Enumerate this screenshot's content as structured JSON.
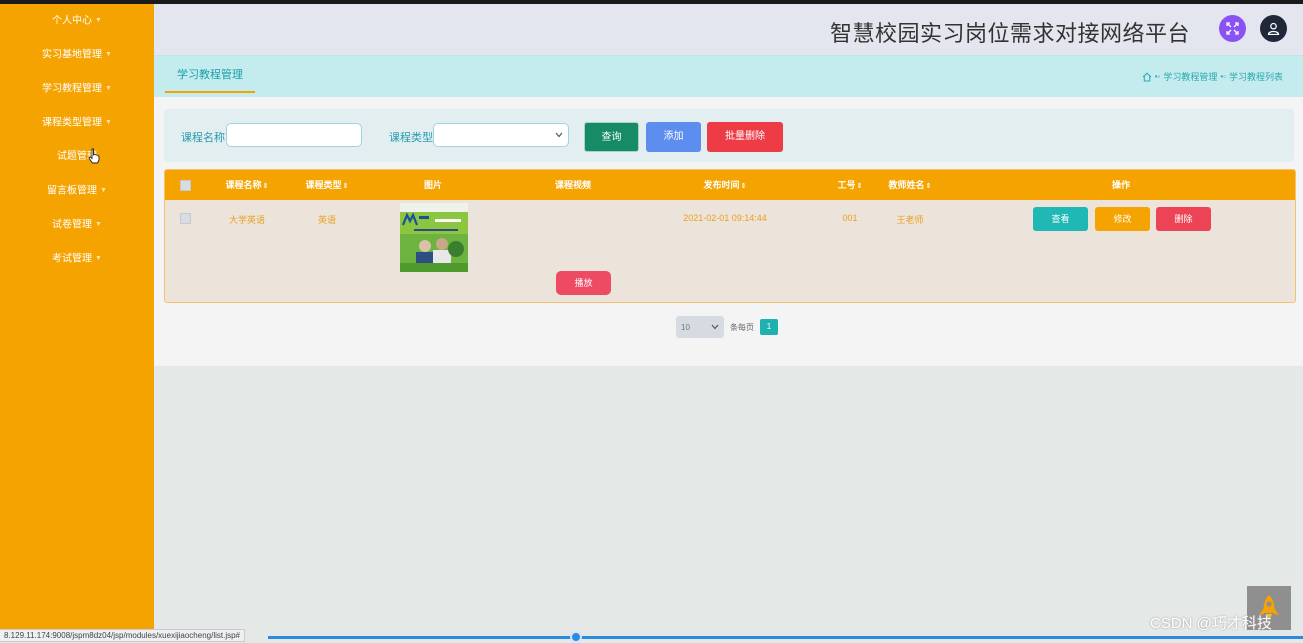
{
  "sidebar": {
    "items": [
      {
        "label": "个人中心",
        "caret": true
      },
      {
        "label": "实习基地管理",
        "caret": true
      },
      {
        "label": "学习教程管理",
        "caret": true
      },
      {
        "label": "课程类型管理",
        "caret": true
      },
      {
        "label": "试题管理",
        "caret": false
      },
      {
        "label": "留言板管理",
        "caret": true
      },
      {
        "label": "试卷管理",
        "caret": true
      },
      {
        "label": "考试管理",
        "caret": true
      }
    ]
  },
  "header": {
    "title": "智慧校园实习岗位需求对接网络平台"
  },
  "tabs": {
    "active": "学习教程管理"
  },
  "breadcrumb": {
    "items": [
      "学习教程管理",
      "学习教程列表"
    ]
  },
  "search": {
    "name_label": "课程名称",
    "name_value": "",
    "type_label": "课程类型",
    "type_value": "",
    "query_button": "查询",
    "add_button": "添加",
    "batch_delete_button": "批量删除"
  },
  "table": {
    "columns": [
      "课程名称",
      "课程类型",
      "图片",
      "课程视频",
      "发布时间",
      "工号",
      "教师姓名",
      "操作"
    ],
    "rows": [
      {
        "course_name": "大学英语",
        "course_type": "英语",
        "video_button": "播放",
        "publish_time": "2021-02-01 09:14:44",
        "job_number": "001",
        "teacher_name": "王老师",
        "view_button": "查看",
        "edit_button": "修改",
        "delete_button": "删除"
      }
    ]
  },
  "pagination": {
    "page_size": "10",
    "per_page_label": "条每页",
    "current_page": "1"
  },
  "status_bar": {
    "url": "8.129.11.174:9008/jspm8dz04/jsp/modules/xuexijiaocheng/list.jsp#"
  },
  "watermark": "CSDN @巧才科技",
  "colors": {
    "sidebar_bg": "#f5a300",
    "accent_teal": "#1fb8b4",
    "query_green": "#178a66",
    "add_blue": "#5e8df0",
    "danger_red": "#ed3c46"
  }
}
